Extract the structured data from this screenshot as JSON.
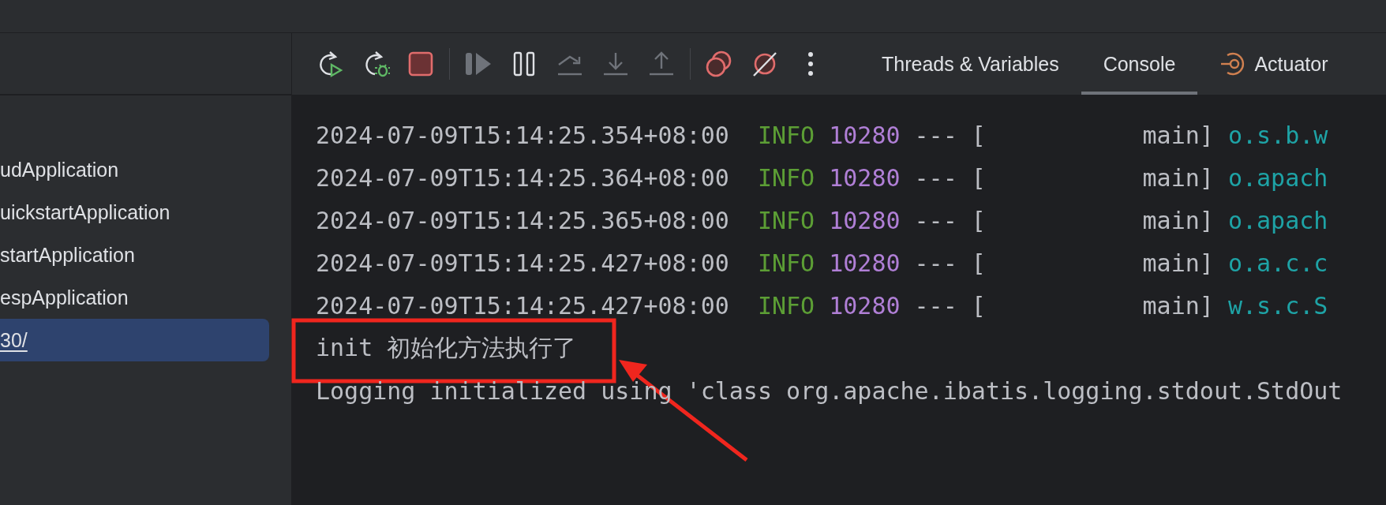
{
  "sidebar": {
    "items": [
      {
        "label": "udApplication",
        "kind": "config",
        "selected": false
      },
      {
        "label": "uickstartApplication",
        "kind": "config",
        "selected": false
      },
      {
        "label": "startApplication",
        "kind": "config",
        "selected": false
      },
      {
        "label": "espApplication",
        "kind": "config",
        "selected": false
      },
      {
        "label": "30/",
        "kind": "link",
        "selected": true
      }
    ]
  },
  "toolbar": {
    "items": [
      {
        "kind": "button",
        "disabled": false
      },
      {
        "kind": "button",
        "disabled": false
      },
      {
        "kind": "button",
        "disabled": false
      },
      {
        "kind": "separator"
      },
      {
        "kind": "button",
        "disabled": true
      },
      {
        "kind": "button",
        "disabled": false
      },
      {
        "kind": "button",
        "disabled": true
      },
      {
        "kind": "button",
        "disabled": true
      },
      {
        "kind": "button",
        "disabled": true
      },
      {
        "kind": "separator"
      },
      {
        "kind": "button",
        "disabled": false
      },
      {
        "kind": "button",
        "disabled": false
      },
      {
        "kind": "button",
        "disabled": false
      }
    ]
  },
  "tabs": [
    {
      "label": "Threads & Variables",
      "kind": "text",
      "selected": false
    },
    {
      "label": "Console",
      "kind": "text",
      "selected": true
    },
    {
      "label": "Actuator",
      "kind": "icon_text",
      "selected": false
    }
  ],
  "console": {
    "lines": [
      {
        "kind": "log",
        "timestamp": "2024-07-09T15:14:25.354+08:00",
        "level": "INFO",
        "pid": "10280",
        "separator": "---",
        "thread": "[           main]",
        "logger": "o.s.b.w"
      },
      {
        "kind": "log",
        "timestamp": "2024-07-09T15:14:25.364+08:00",
        "level": "INFO",
        "pid": "10280",
        "separator": "---",
        "thread": "[           main]",
        "logger": "o.apach"
      },
      {
        "kind": "log",
        "timestamp": "2024-07-09T15:14:25.365+08:00",
        "level": "INFO",
        "pid": "10280",
        "separator": "---",
        "thread": "[           main]",
        "logger": "o.apach"
      },
      {
        "kind": "log",
        "timestamp": "2024-07-09T15:14:25.427+08:00",
        "level": "INFO",
        "pid": "10280",
        "separator": "---",
        "thread": "[           main]",
        "logger": "o.a.c.c"
      },
      {
        "kind": "log",
        "timestamp": "2024-07-09T15:14:25.427+08:00",
        "level": "INFO",
        "pid": "10280",
        "separator": "---",
        "thread": "[           main]",
        "logger": "w.s.c.S"
      },
      {
        "kind": "plain",
        "text": "init 初始化方法执行了"
      },
      {
        "kind": "plain",
        "text": "Logging initialized using 'class org.apache.ibatis.logging.stdout.StdOut"
      }
    ]
  }
}
